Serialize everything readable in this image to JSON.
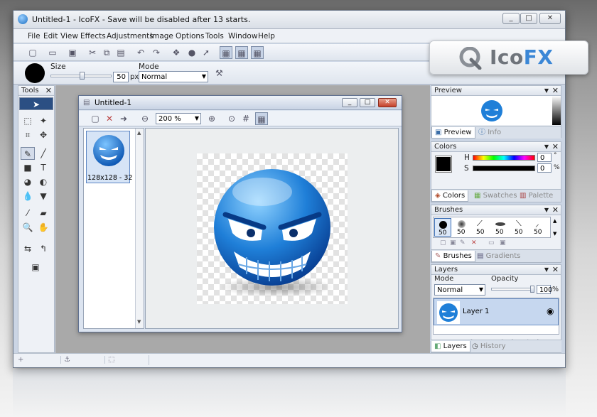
{
  "window": {
    "title": "Untitled-1 - IcoFX - Save will be disabled after 13 starts.",
    "controls": [
      "_",
      "□",
      "✕"
    ]
  },
  "menu": [
    "File",
    "Edit",
    "View",
    "Effects",
    "Adjustments",
    "Image",
    "Options",
    "Tools",
    "Window",
    "Help"
  ],
  "options_bar": {
    "size_label": "Size",
    "size_value": "50",
    "size_unit": "px",
    "mode_label": "Mode",
    "mode_value": "Normal"
  },
  "tools_panel": {
    "title": "Tools"
  },
  "document": {
    "title": "Untitled-1",
    "zoom": "200 %",
    "thumbnail_caption": "128x128 - 32"
  },
  "preview_panel": {
    "title": "Preview",
    "tabs": [
      "Preview",
      "Info"
    ]
  },
  "colors_panel": {
    "title": "Colors",
    "h_label": "H",
    "s_label": "S",
    "h_value": "0",
    "s_value": "0",
    "h_unit": "°",
    "s_unit": "%",
    "tabs": [
      "Colors",
      "Swatches",
      "Palette"
    ],
    "primary_color": "#000000"
  },
  "brushes_panel": {
    "title": "Brushes",
    "sizes": [
      "50",
      "50",
      "50",
      "50",
      "50",
      "50"
    ],
    "tabs": [
      "Brushes",
      "Gradients"
    ]
  },
  "layers_panel": {
    "title": "Layers",
    "mode_label": "Mode",
    "mode_value": "Normal",
    "opacity_label": "Opacity",
    "opacity_value": "100",
    "opacity_unit": "%",
    "layer_name": "Layer 1",
    "tabs": [
      "Layers",
      "History"
    ]
  },
  "logo": {
    "text_a": "Ico",
    "text_b": "FX"
  },
  "colors": {
    "accent": "#3b87d6",
    "face": "#1f7fd8"
  }
}
